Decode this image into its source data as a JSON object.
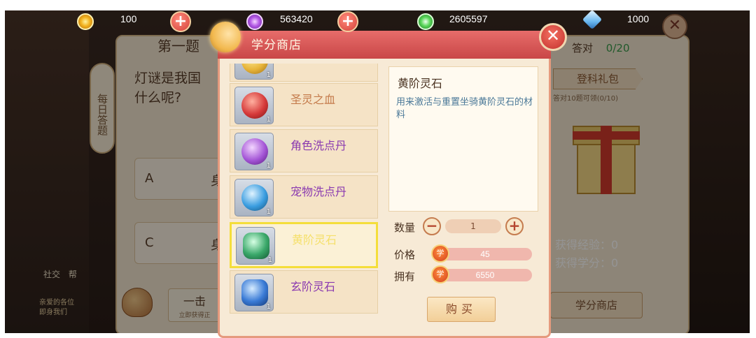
{
  "topbar": {
    "gold": {
      "value": "100",
      "icon": "gold-coin-icon"
    },
    "purple": {
      "value": "563420",
      "icon": "purple-gem-icon"
    },
    "green": {
      "value": "2605597",
      "icon": "green-jade-icon"
    },
    "diamond": {
      "value": "1000",
      "icon": "diamond-icon"
    }
  },
  "background": {
    "question_title": "第一题",
    "question_text": "灯谜是我国",
    "question_text2": "什么呢?",
    "option_a": "A",
    "option_a_tail": "身",
    "option_c": "C",
    "option_c_tail": "身",
    "side_tab": "每日答题",
    "correct_label": "答对",
    "correct_count": "0/20",
    "gift_button": "登科礼包",
    "gift_sub": "答对10题可领(0/10)",
    "exp_text": "获得经验：0",
    "credit_text": "获得学分：0",
    "shop_button": "学分商店",
    "one_click": "一击",
    "one_click_sub": "立即获得正",
    "chat_tag_1": "社交",
    "chat_tag_2": "帮",
    "chat_line_1": "亲爱的各位",
    "chat_line_2": "即身我们"
  },
  "modal": {
    "title": "学分商店",
    "items": [
      {
        "name": "",
        "qty": "1",
        "orb": "#e8b53a",
        "color": "#b07a3a"
      },
      {
        "name": "圣灵之血",
        "qty": "1",
        "orb": "#d63a3a",
        "color": "#c47a4a"
      },
      {
        "name": "角色洗点丹",
        "qty": "1",
        "orb": "#a455d6",
        "color": "#8a3ab0"
      },
      {
        "name": "宠物洗点丹",
        "qty": "1",
        "orb": "#3a9de0",
        "color": "#8a3ab0"
      },
      {
        "name": "黄阶灵石",
        "qty": "1",
        "orb": "#3aa86a",
        "color": "#f5e06a"
      },
      {
        "name": "玄阶灵石",
        "qty": "1",
        "orb": "#3a7bd6",
        "color": "#8a3ab0"
      }
    ],
    "detail": {
      "name": "黄阶灵石",
      "desc": "用来激活与重置坐骑黄阶灵石的材料"
    },
    "quantity_label": "数量",
    "quantity_value": "1",
    "price_label": "价格",
    "price_value": "45",
    "owned_label": "拥有",
    "owned_value": "6550",
    "coin_glyph": "学",
    "buy_button": "购买"
  }
}
